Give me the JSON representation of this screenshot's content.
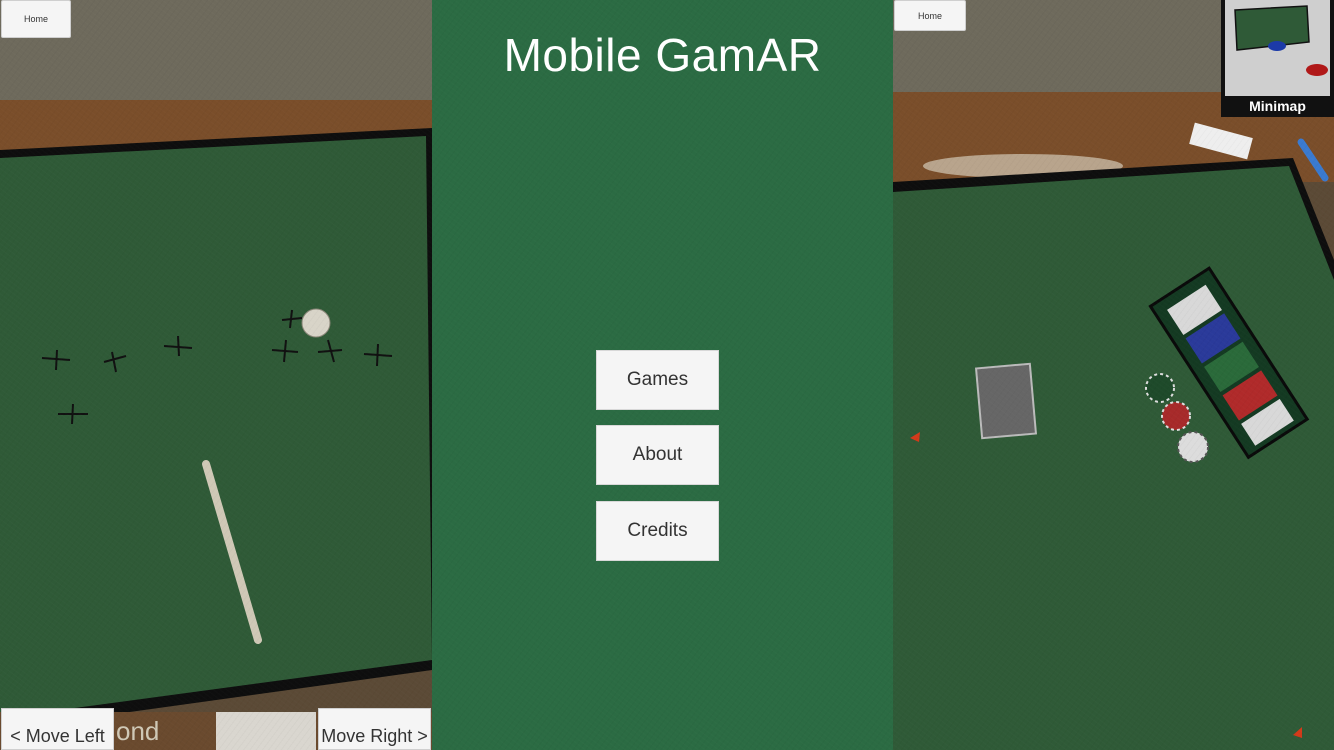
{
  "left_panel": {
    "home_label": "Home",
    "move_left_label": "< Move Left",
    "move_right_label": "Move Right >",
    "bg_text": "ond"
  },
  "center_panel": {
    "title": "Mobile GamAR",
    "menu": [
      {
        "label": "Games"
      },
      {
        "label": "About"
      },
      {
        "label": "Credits"
      }
    ]
  },
  "right_panel": {
    "home_label": "Home",
    "minimap_label": "Minimap"
  },
  "colors": {
    "felt": "#2b6b43",
    "table_felt": "#2f5a37",
    "button_bg": "#f5f5f5",
    "marker_red": "#d33a1a"
  }
}
